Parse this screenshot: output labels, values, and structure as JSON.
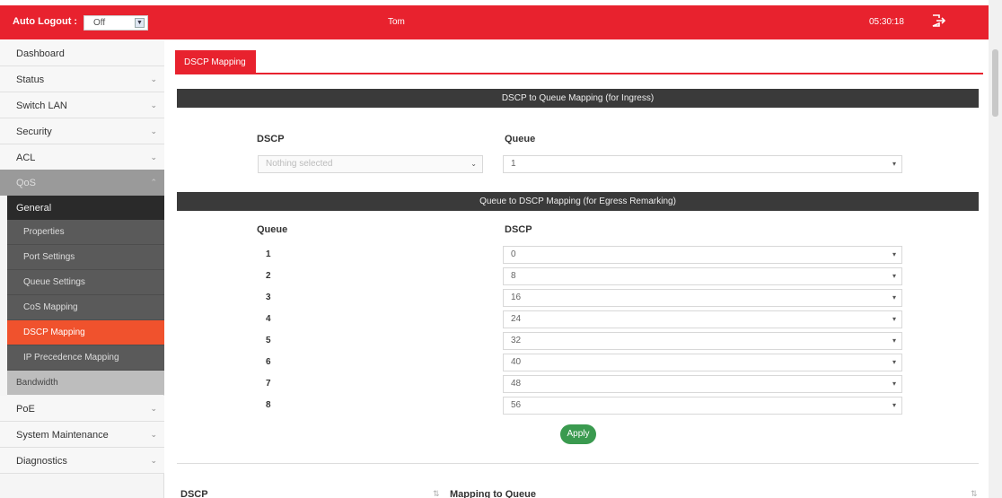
{
  "header": {
    "auto_logout_label": "Auto Logout :",
    "auto_logout_value": "Off",
    "host": "Tom",
    "clock": "05:30:18"
  },
  "sidebar": {
    "items_top": [
      "Dashboard",
      "Status",
      "Switch LAN",
      "Security",
      "ACL"
    ],
    "qos": "QoS",
    "general": "General",
    "sub_items": [
      "Properties",
      "Port Settings",
      "Queue Settings",
      "CoS Mapping",
      "DSCP Mapping",
      "IP Precedence Mapping"
    ],
    "bandwidth": "Bandwidth",
    "items_bottom": [
      "PoE",
      "System Maintenance",
      "Diagnostics"
    ]
  },
  "tab": "DSCP Mapping",
  "ingress": {
    "title": "DSCP to Queue Mapping (for Ingress)",
    "dscp_header": "DSCP",
    "queue_header": "Queue",
    "dscp_placeholder": "Nothing selected",
    "queue_value": "1"
  },
  "egress": {
    "title": "Queue to DSCP Mapping (for Egress Remarking)",
    "queue_header": "Queue",
    "dscp_header": "DSCP",
    "rows": [
      {
        "queue": "1",
        "dscp": "0"
      },
      {
        "queue": "2",
        "dscp": "8"
      },
      {
        "queue": "3",
        "dscp": "16"
      },
      {
        "queue": "4",
        "dscp": "24"
      },
      {
        "queue": "5",
        "dscp": "32"
      },
      {
        "queue": "6",
        "dscp": "40"
      },
      {
        "queue": "7",
        "dscp": "48"
      },
      {
        "queue": "8",
        "dscp": "56"
      }
    ]
  },
  "apply_label": "Apply",
  "table": {
    "col_dscp": "DSCP",
    "col_mapping": "Mapping to Queue"
  },
  "colors": {
    "brand_red": "#e8222e",
    "active_orange": "#f0522d",
    "apply_green": "#3a9a4f"
  }
}
